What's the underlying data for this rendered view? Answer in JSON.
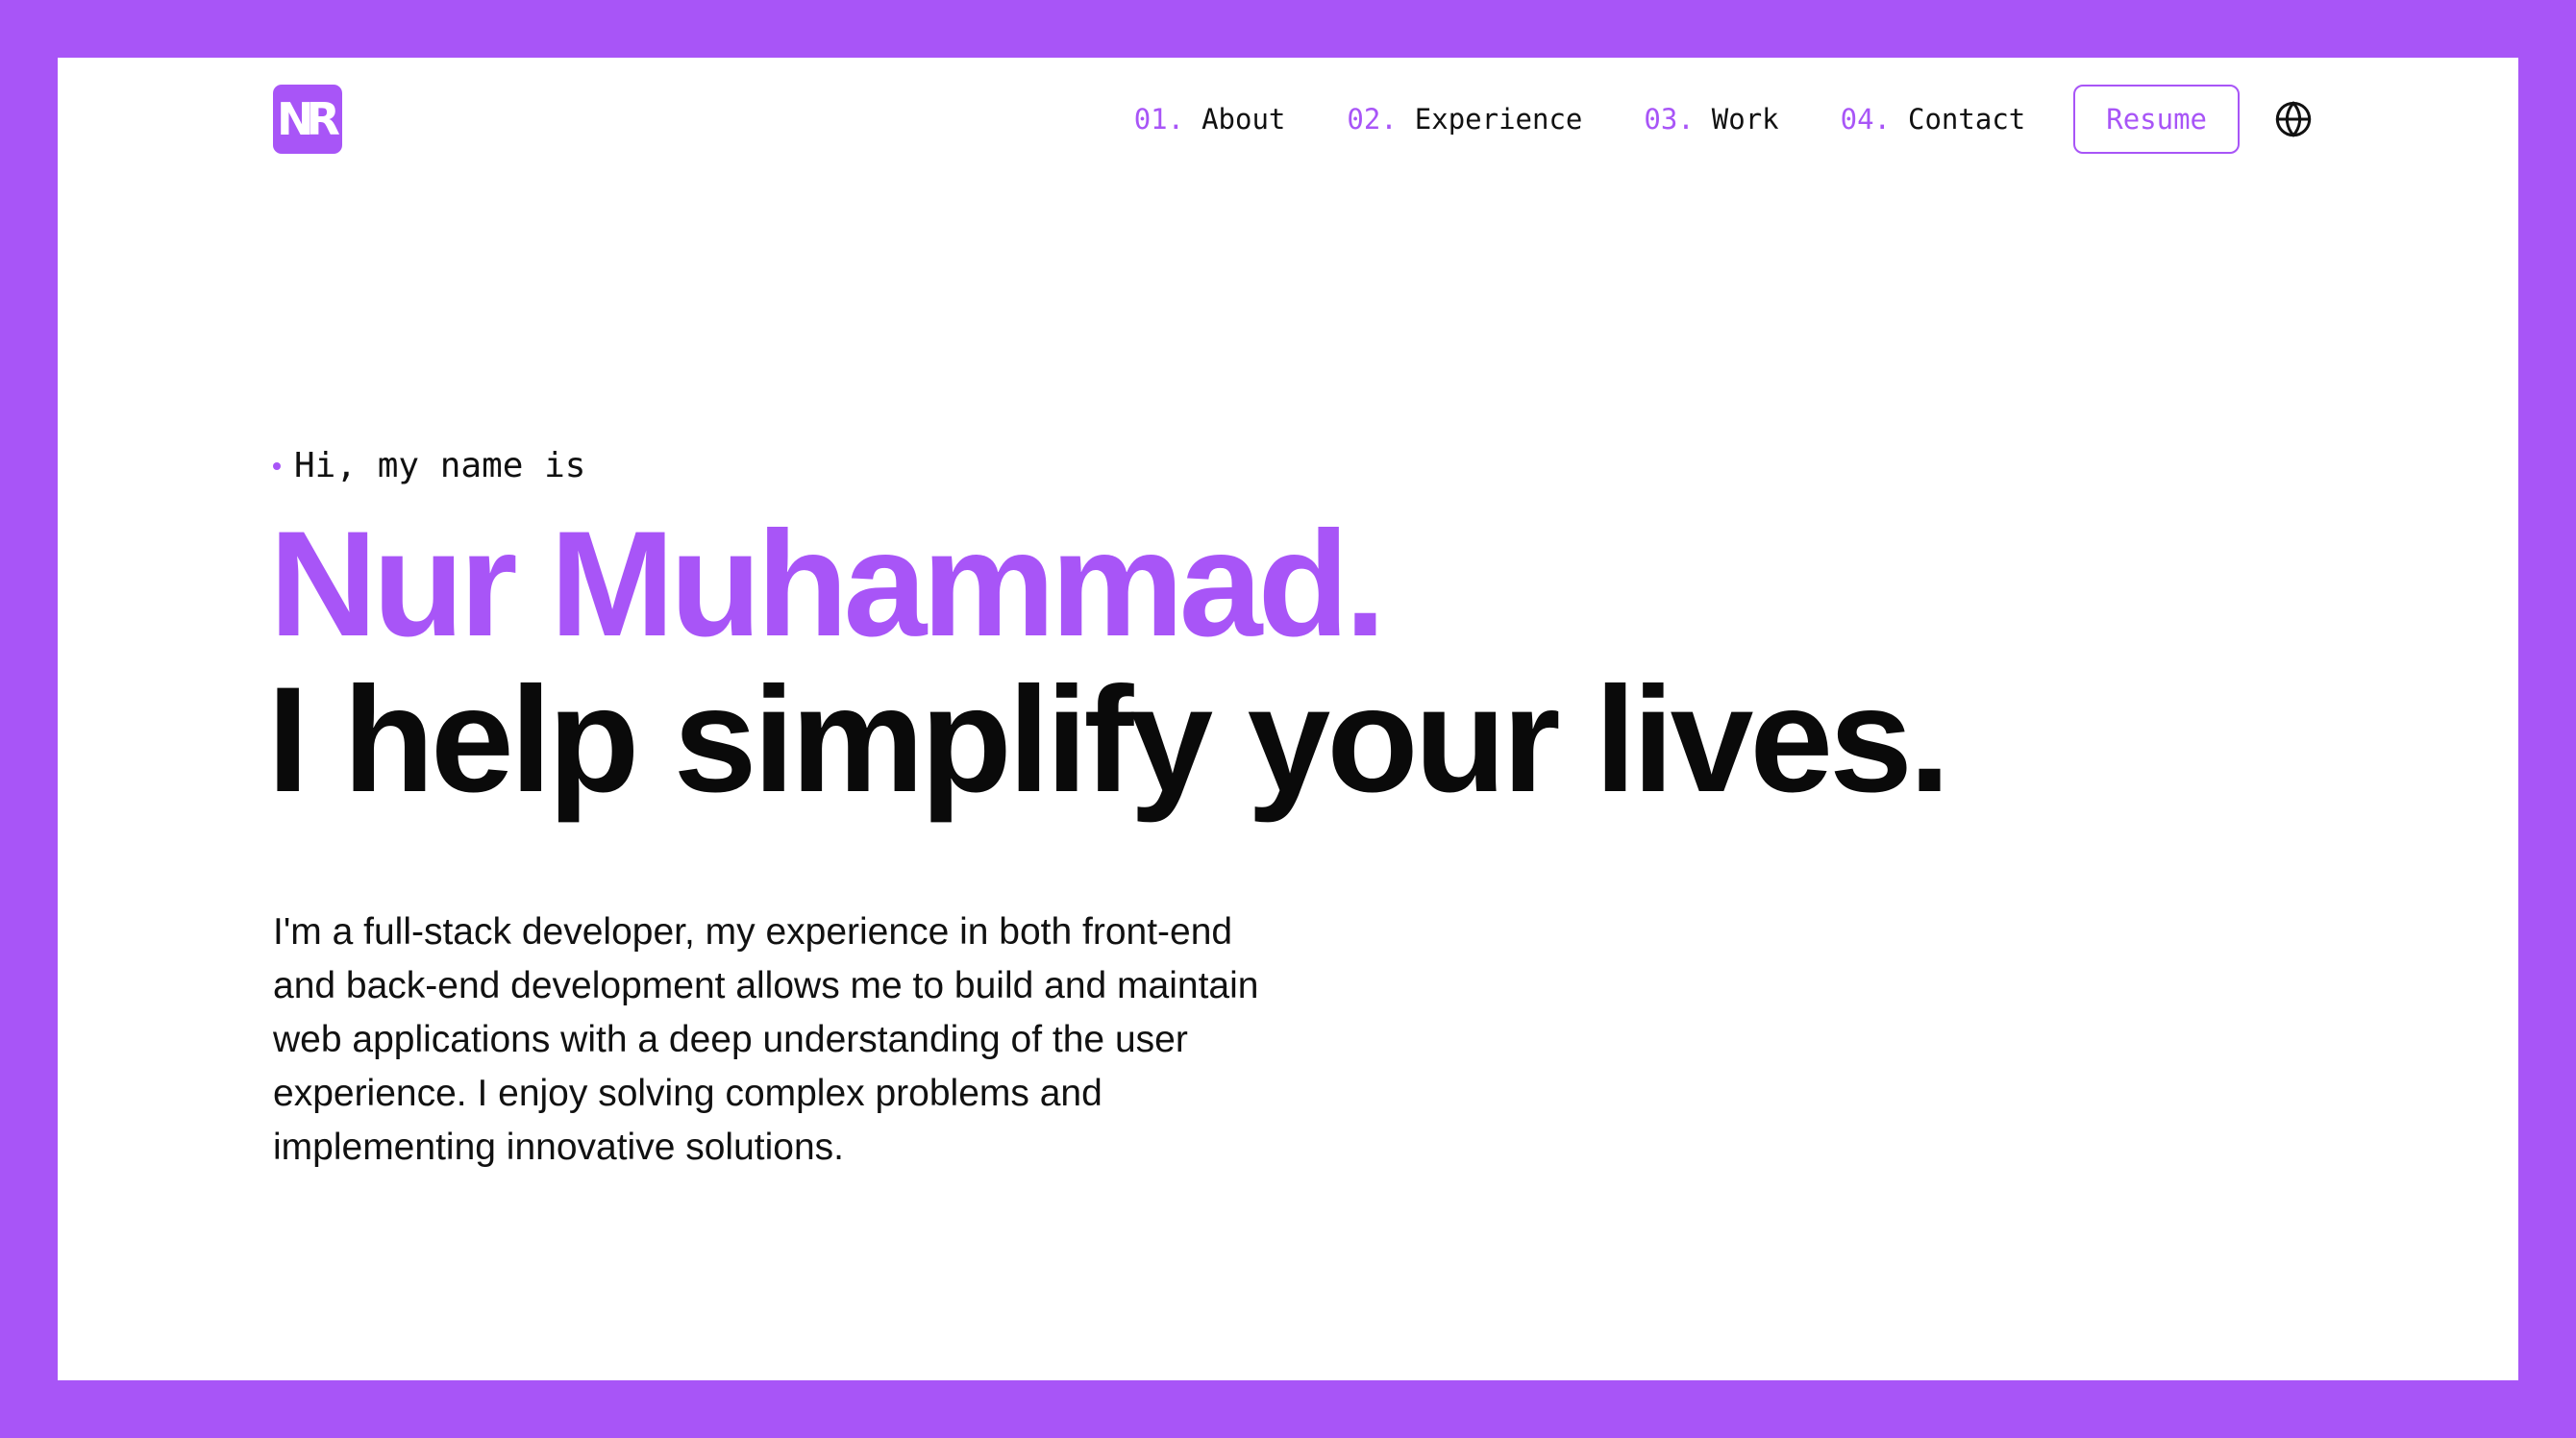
{
  "colors": {
    "accent": "#a855f7",
    "background": "#ffffff",
    "text": "#111111"
  },
  "header": {
    "logo_text": "NR",
    "nav": [
      {
        "num": "01.",
        "label": "About"
      },
      {
        "num": "02.",
        "label": "Experience"
      },
      {
        "num": "03.",
        "label": "Work"
      },
      {
        "num": "04.",
        "label": "Contact"
      }
    ],
    "resume_label": "Resume",
    "language_icon": "globe-icon"
  },
  "hero": {
    "greeting": "Hi, my name is",
    "name": "Nur Muhammad.",
    "tagline": "I help simplify your lives.",
    "bio": "I'm a full-stack developer, my experience in both front-end and back-end development allows me to build and maintain web applications with a deep understanding of the user experience. I enjoy solving complex problems and implementing innovative solutions."
  }
}
